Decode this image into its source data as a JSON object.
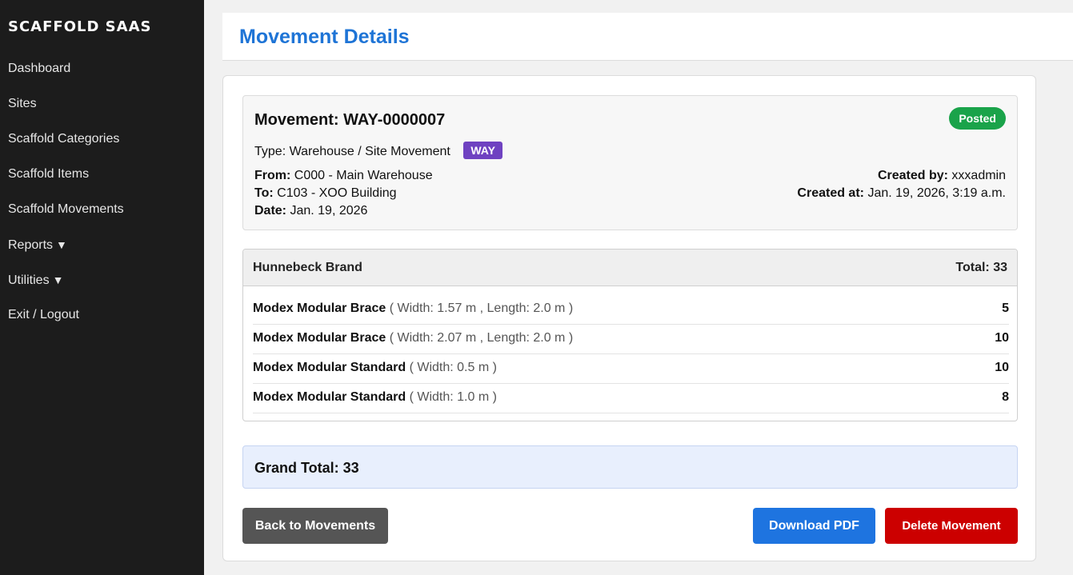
{
  "brand": "SCAFFOLD SAAS",
  "nav": [
    {
      "label": "Dashboard",
      "caret": ""
    },
    {
      "label": "Sites",
      "caret": ""
    },
    {
      "label": "Scaffold Categories",
      "caret": ""
    },
    {
      "label": "Scaffold Items",
      "caret": ""
    },
    {
      "label": "Scaffold Movements",
      "caret": ""
    },
    {
      "label": "Reports",
      "caret": "▼"
    },
    {
      "label": "Utilities",
      "caret": "▼"
    },
    {
      "label": "Exit / Logout",
      "caret": ""
    }
  ],
  "page_title": "Movement Details",
  "movement": {
    "title": "Movement: WAY-0000007",
    "status": "Posted",
    "type_label": "Type:",
    "type_value": "Warehouse / Site Movement",
    "type_code": "WAY",
    "from_label": "From:",
    "from_value": "C000 - Main Warehouse",
    "to_label": "To:",
    "to_value": "C103 - XOO Building",
    "date_label": "Date:",
    "date_value": "Jan. 19, 2026",
    "created_by_label": "Created by:",
    "created_by_value": "xxxadmin",
    "created_at_label": "Created at:",
    "created_at_value": "Jan. 19, 2026, 3:19 a.m."
  },
  "group": {
    "name": "Hunnebeck Brand",
    "total": "Total: 33",
    "items": [
      {
        "name": "Modex Modular Brace",
        "dims": "( Width: 1.57 m , Length: 2.0 m )",
        "qty": "5"
      },
      {
        "name": "Modex Modular Brace",
        "dims": "( Width: 2.07 m , Length: 2.0 m )",
        "qty": "10"
      },
      {
        "name": "Modex Modular Standard",
        "dims": "( Width: 0.5 m )",
        "qty": "10"
      },
      {
        "name": "Modex Modular Standard",
        "dims": "( Width: 1.0 m )",
        "qty": "8"
      }
    ]
  },
  "grand_total": "Grand Total: 33",
  "buttons": {
    "back": "Back to Movements",
    "pdf": "Download PDF",
    "delete": "Delete Movement"
  },
  "colors": {
    "sidebar": "#1c1c1c",
    "title_blue": "#1e74d6",
    "status_green": "#1aa34a",
    "type_purple": "#6f42c1",
    "back_gray": "#555555",
    "pdf_blue": "#1e74e0",
    "delete_red": "#cc0000"
  }
}
